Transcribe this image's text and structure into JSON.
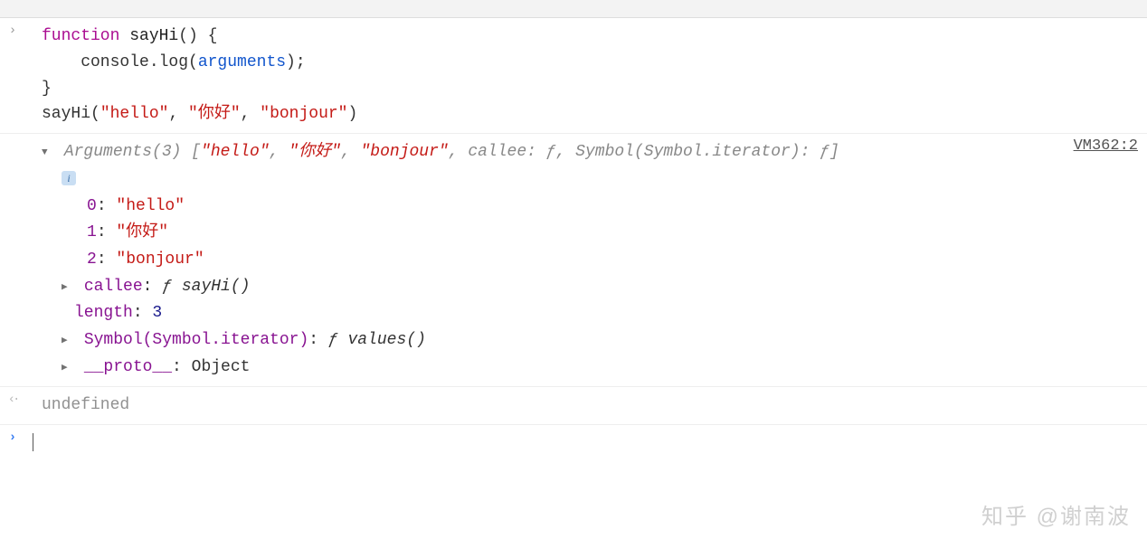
{
  "input": {
    "line1_kw": "function",
    "line1_name": " sayHi",
    "line1_rest": "() {",
    "line2a": "    console.log(",
    "line2b": "arguments",
    "line2c": ");",
    "line3": "}",
    "line4a": "sayHi(",
    "line4_s1": "\"hello\"",
    "line4_s2": "\"你好\"",
    "line4_s3": "\"bonjour\"",
    "line4z": ")"
  },
  "source_link": "VM362:2",
  "summary": {
    "prefix": "Arguments(3) [",
    "s1": "\"hello\"",
    "s2": "\"你好\"",
    "s3": "\"bonjour\"",
    "callee_k": "callee: ",
    "f": "ƒ",
    "sym_k": "Symbol(Symbol.iterator): ",
    "suffix": "]"
  },
  "props": {
    "idx0_k": "0",
    "idx0_v": "\"hello\"",
    "idx1_k": "1",
    "idx1_v": "\"你好\"",
    "idx2_k": "2",
    "idx2_v": "\"bonjour\"",
    "callee_k": "callee",
    "callee_v": "ƒ sayHi()",
    "length_k": "length",
    "length_v": "3",
    "symiter_k": "Symbol(Symbol.iterator)",
    "symiter_v": "ƒ values()",
    "proto_k": "__proto__",
    "proto_v": "Object"
  },
  "return_value": "undefined",
  "watermark": "知乎 @谢南波"
}
